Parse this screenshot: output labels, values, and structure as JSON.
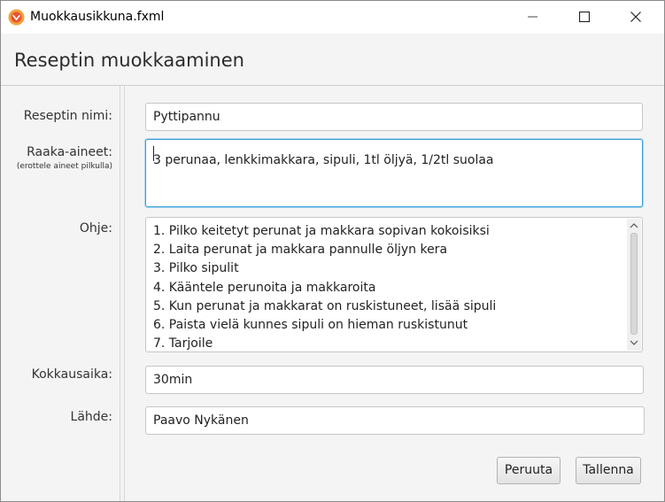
{
  "window": {
    "title": "Muokkausikkuna.fxml",
    "controls": {
      "minimize": "minimize-icon",
      "maximize": "maximize-icon",
      "close": "close-icon"
    }
  },
  "header": {
    "title": "Reseptin muokkaaminen"
  },
  "form": {
    "name": {
      "label": "Reseptin nimi:",
      "value": "Pyttipannu"
    },
    "ingredients": {
      "label": "Raaka-aineet:",
      "hint": "(erottele aineet pilkulla)",
      "value": "3 perunaa, lenkkimakkara, sipuli, 1tl öljyä, 1/2tl suolaa"
    },
    "instructions": {
      "label": "Ohje:",
      "lines": [
        "1. Pilko keitetyt perunat ja makkara sopivan kokoisiksi",
        "2. Laita perunat ja makkara pannulle öljyn kera",
        "3. Pilko sipulit",
        "4. Kääntele perunoita ja makkaroita",
        "5. Kun perunat ja makkarat on ruskistuneet, lisää sipuli",
        "6. Paista vielä kunnes sipuli on hieman ruskistunut",
        "7. Tarjoile"
      ]
    },
    "cooking_time": {
      "label": "Kokkausaika:",
      "value": "30min"
    },
    "source": {
      "label": "Lähde:",
      "value": "Paavo Nykänen"
    }
  },
  "buttons": {
    "cancel": "Peruuta",
    "save": "Tallenna"
  },
  "colors": {
    "focus": "#3aa0d8",
    "app_icon": "#f0a23c"
  }
}
